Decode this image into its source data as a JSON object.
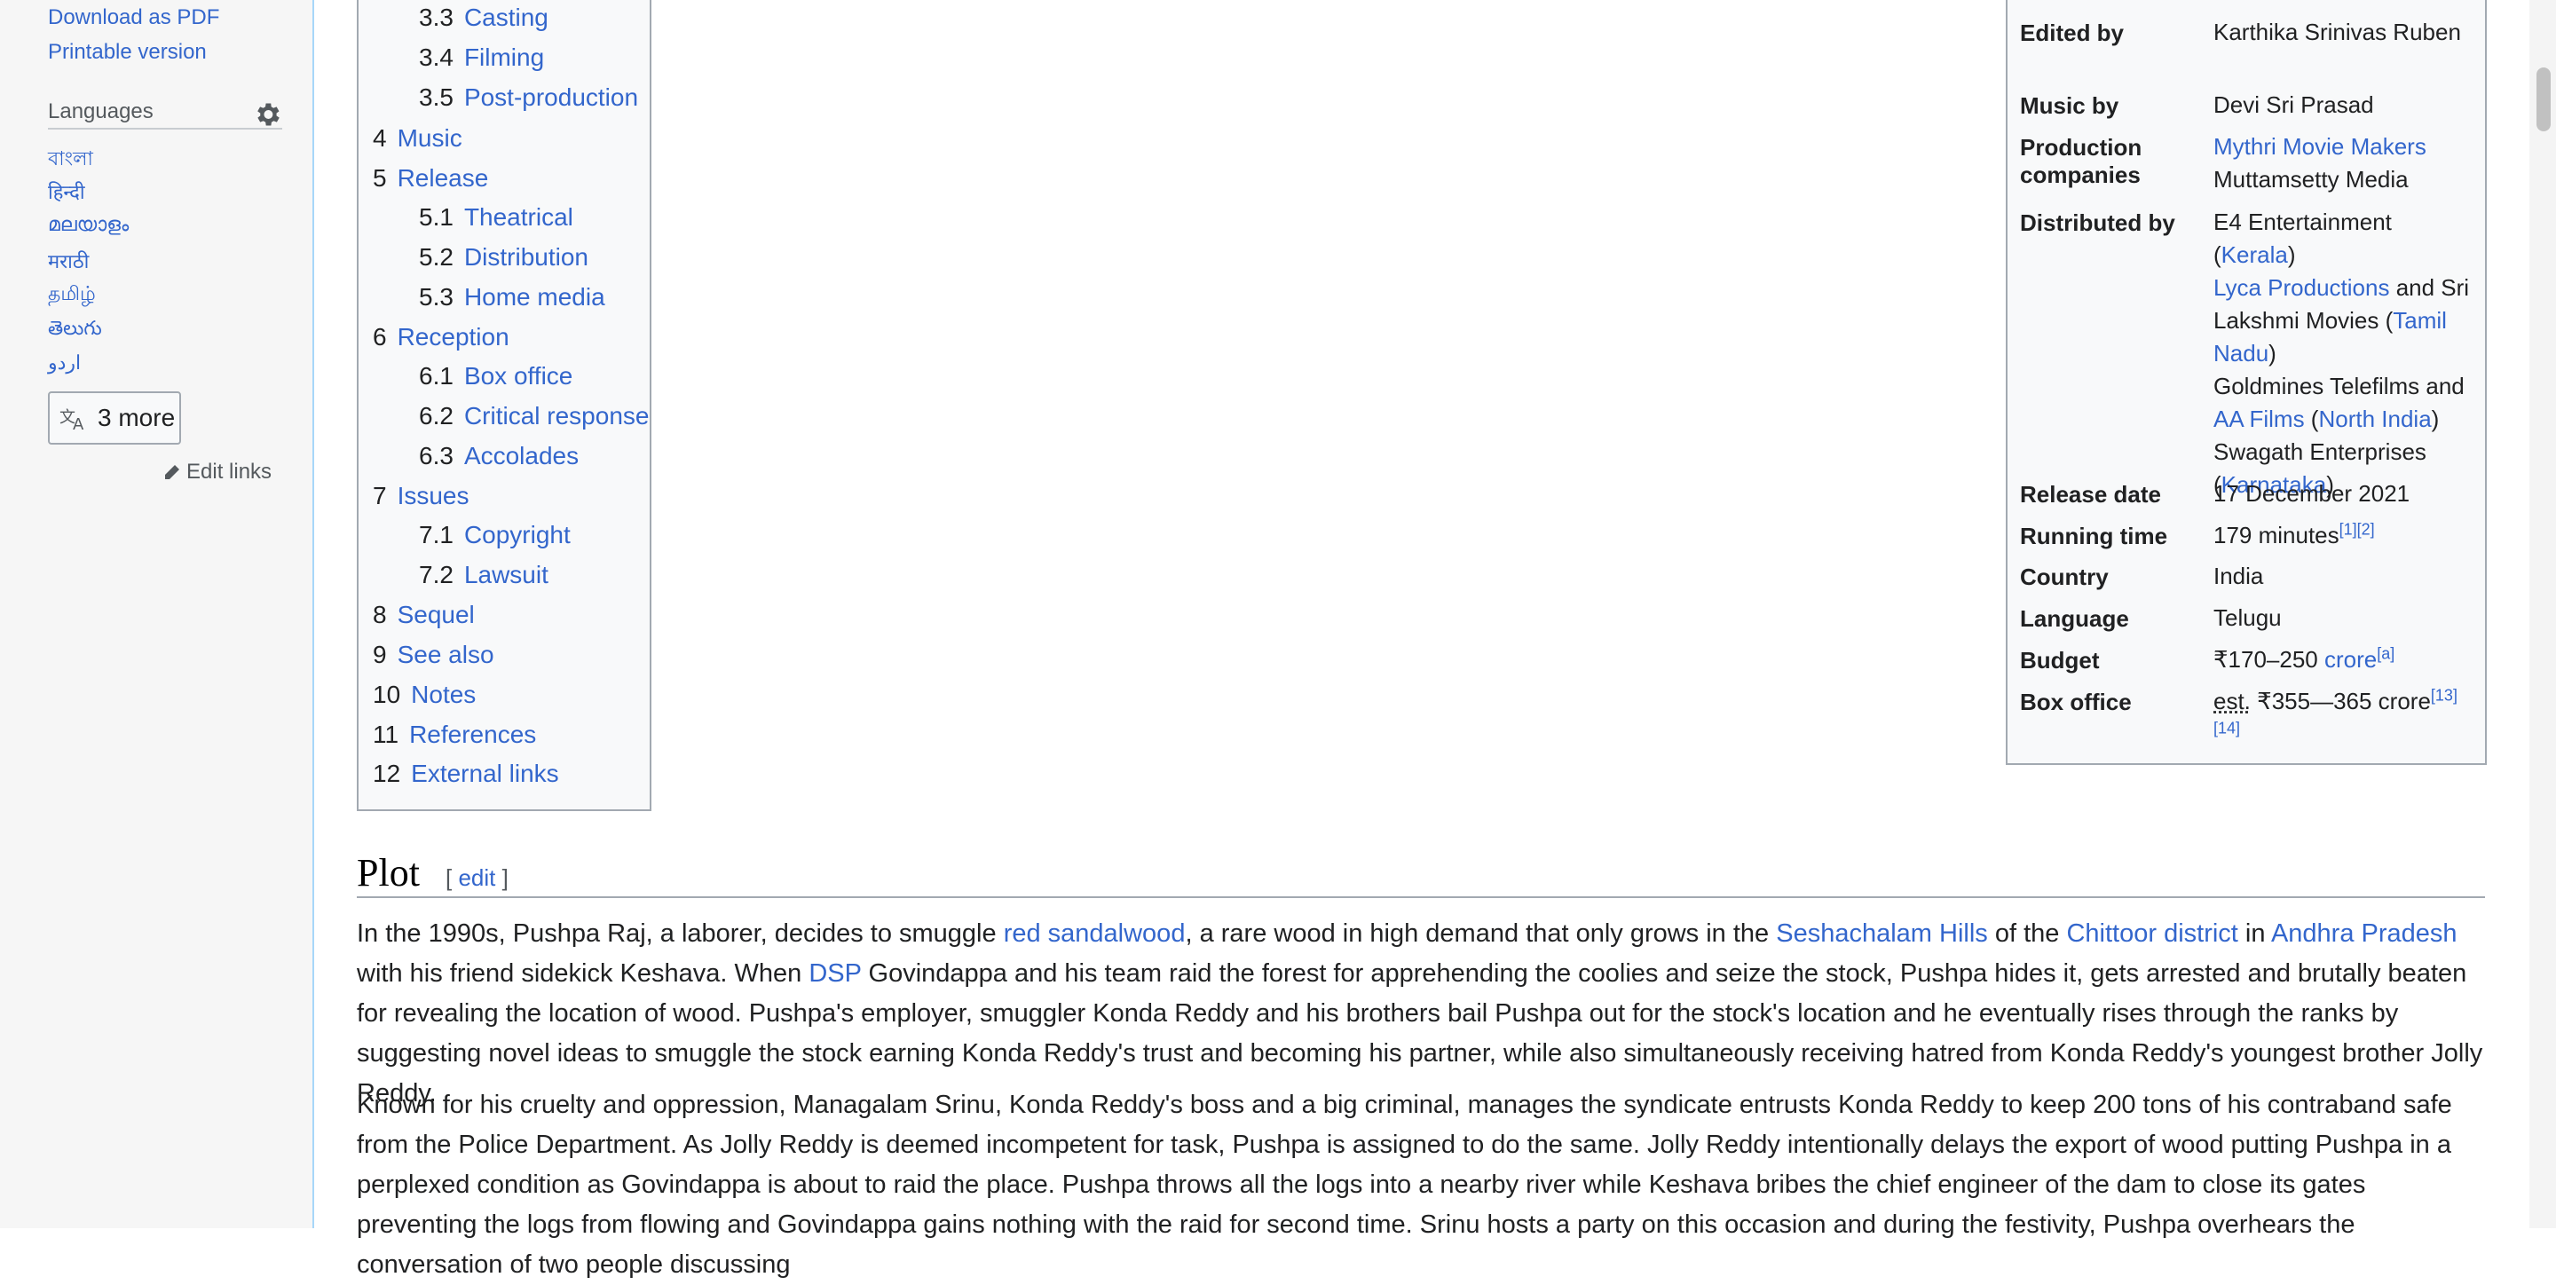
{
  "sidebar": {
    "download_pdf": "Download as PDF",
    "printable": "Printable version",
    "languages_heading": "Languages",
    "languages": [
      "বাংলা",
      "हिन्दी",
      "മലയാളം",
      "मराठी",
      "தமிழ்",
      "తెలుగు",
      "اردو"
    ],
    "more_label": "3 more",
    "edit_links": "Edit links"
  },
  "toc": {
    "items": [
      {
        "num": "3.3",
        "label": "Casting"
      },
      {
        "num": "3.4",
        "label": "Filming"
      },
      {
        "num": "3.5",
        "label": "Post-production"
      },
      {
        "num": "4",
        "label": "Music"
      },
      {
        "num": "5",
        "label": "Release"
      },
      {
        "num": "5.1",
        "label": "Theatrical"
      },
      {
        "num": "5.2",
        "label": "Distribution"
      },
      {
        "num": "5.3",
        "label": "Home media"
      },
      {
        "num": "6",
        "label": "Reception"
      },
      {
        "num": "6.1",
        "label": "Box office"
      },
      {
        "num": "6.2",
        "label": "Critical response"
      },
      {
        "num": "6.3",
        "label": "Accolades"
      },
      {
        "num": "7",
        "label": "Issues"
      },
      {
        "num": "7.1",
        "label": "Copyright"
      },
      {
        "num": "7.2",
        "label": "Lawsuit"
      },
      {
        "num": "8",
        "label": "Sequel"
      },
      {
        "num": "9",
        "label": "See also"
      },
      {
        "num": "10",
        "label": "Notes"
      },
      {
        "num": "11",
        "label": "References"
      },
      {
        "num": "12",
        "label": "External links"
      }
    ]
  },
  "infobox": {
    "edited_by": {
      "label": "Edited by",
      "value": "Karthika Srinivas Ruben"
    },
    "music_by": {
      "label": "Music by",
      "value": "Devi Sri Prasad"
    },
    "production": {
      "label": "Production companies",
      "value1": "Mythri Movie Makers",
      "value2": "Muttamsetty Media"
    },
    "distributed": {
      "label": "Distributed by",
      "e4": "E4 Entertainment (",
      "kerala": "Kerala",
      "close": ")",
      "lyca": "Lyca Productions",
      "and_sri": " and Sri Lakshmi Movies (",
      "tamil": "Tamil Nadu",
      "goldmines": "Goldmines Telefilms and ",
      "aa": "AA Films",
      "open": " (",
      "north": "North India",
      "swagath": "Swagath Enterprises (",
      "karnataka": "Karnataka"
    },
    "release_date": {
      "label": "Release date",
      "value": "17 December 2021"
    },
    "running_time": {
      "label": "Running time",
      "value": "179 minutes",
      "ref1": "[1]",
      "ref2": "[2]"
    },
    "country": {
      "label": "Country",
      "value": "India"
    },
    "language": {
      "label": "Language",
      "value": "Telugu"
    },
    "budget": {
      "label": "Budget",
      "value": "₹170–250 ",
      "link": "crore",
      "ref": "[a]"
    },
    "box_office": {
      "label": "Box office",
      "est": "est.",
      "value": " ₹355—365 crore",
      "ref1": "[13]",
      "ref2": "[14]"
    }
  },
  "plot": {
    "heading": "Plot",
    "edit_open": "[ ",
    "edit": "edit",
    "edit_close": " ]",
    "p1": {
      "t1": "In the 1990s, Pushpa Raj, a laborer, decides to smuggle ",
      "l1": "red sandalwood",
      "t2": ", a rare wood in high demand that only grows in the ",
      "l2": "Seshachalam Hills",
      "t3": " of the ",
      "l3": "Chittoor district",
      "t4": " in ",
      "l4": "Andhra Pradesh",
      "t5": " with his friend sidekick Keshava. When ",
      "l5": "DSP",
      "t6": " Govindappa and his team raid the forest for apprehending the coolies and seize the stock, Pushpa hides it, gets arrested and brutally beaten for revealing the location of wood. Pushpa's employer, smuggler Konda Reddy and his brothers bail Pushpa out for the stock's location and he eventually rises through the ranks by suggesting novel ideas to smuggle the stock earning Konda Reddy's trust and becoming his partner, while also simultaneously receiving hatred from Konda Reddy's youngest brother Jolly Reddy."
    },
    "p2": "Known for his cruelty and oppression, Managalam Srinu, Konda Reddy's boss and a big criminal, manages the syndicate entrusts Konda Reddy to keep 200 tons of his contraband safe from the Police Department. As Jolly Reddy is deemed incompetent for task, Pushpa is assigned to do the same. Jolly Reddy intentionally delays the export of wood putting Pushpa in a perplexed condition as Govindappa is about to raid the place. Pushpa throws all the logs into a nearby river while Keshava bribes the chief engineer of the dam to close its gates preventing the logs from flowing and Govindappa gains nothing with the raid for second time. Srinu hosts a party on this occasion and during the festivity, Pushpa overhears the conversation of two people discussing"
  }
}
